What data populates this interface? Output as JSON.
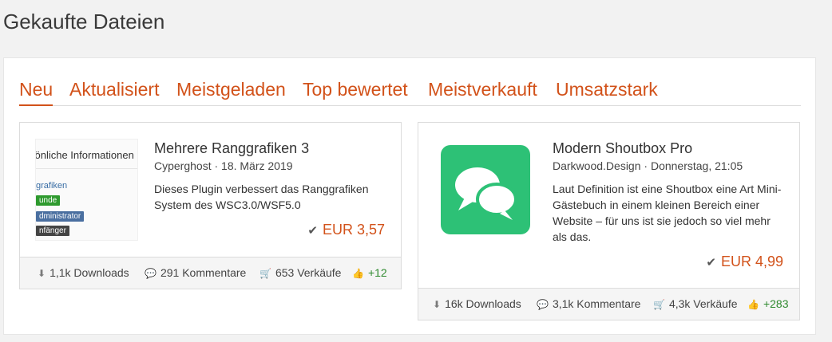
{
  "page": {
    "title": "Gekaufte Dateien"
  },
  "tabs": [
    {
      "label": "Neu",
      "active": true
    },
    {
      "label": "Aktualisiert"
    },
    {
      "label": "Meistgeladen"
    },
    {
      "label": "Top bewertet"
    },
    {
      "label": "Meistverkauft"
    },
    {
      "label": "Umsatzstark"
    }
  ],
  "cards": [
    {
      "title": "Mehrere Ranggrafiken 3",
      "author": "Cyperghost",
      "date": "18. März 2019",
      "description": "Dieses Plugin verbessert das Ranggrafiken System des WSC3.0/WSF5.0",
      "price": "EUR 3,57",
      "thumbnail": {
        "heading": "sönliche Informationen",
        "link": "grafiken",
        "badges": [
          {
            "text": "unde",
            "color": "#2e9a2e"
          },
          {
            "text": "dministrator",
            "color": "#4a6fa0"
          },
          {
            "text": "nfänger",
            "color": "#444444"
          }
        ]
      },
      "footer": {
        "downloads": "1,1k Downloads",
        "comments": "291 Kommentare",
        "sales": "653 Verkäufe",
        "likes": "+12"
      }
    },
    {
      "title": "Modern Shoutbox Pro",
      "author": "Darkwood.Design",
      "date": "Donnerstag, 21:05",
      "description": "Laut Definition ist eine Shoutbox eine Art Mini-Gästebuch in einem kleinen Bereich einer Website – für uns ist sie jedoch so viel mehr als das.",
      "price": "EUR 4,99",
      "thumbnail": {
        "icon": "chat-bubbles-icon",
        "color": "#2dc176"
      },
      "footer": {
        "downloads": "16k Downloads",
        "comments": "3,1k Kommentare",
        "sales": "4,3k Verkäufe",
        "likes": "+283"
      }
    }
  ],
  "colors": {
    "accent": "#d2521a",
    "like": "#2f8a2f"
  }
}
